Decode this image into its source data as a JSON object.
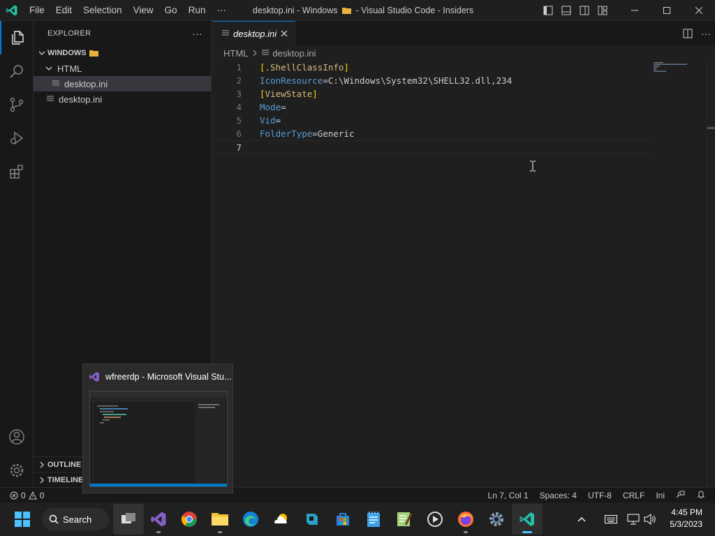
{
  "titlebar": {
    "menu": [
      "File",
      "Edit",
      "Selection",
      "View",
      "Go",
      "Run",
      "···"
    ],
    "title_prefix": "desktop.ini - Windows",
    "title_suffix": "- Visual Studio Code - Insiders"
  },
  "sidebar": {
    "header": "EXPLORER",
    "more": "···",
    "root": "WINDOWS",
    "folder": "HTML",
    "nested_file": "desktop.ini",
    "root_file": "desktop.ini",
    "outline": "OUTLINE",
    "timeline": "TIMELINE"
  },
  "editor": {
    "tab_label": "desktop.ini",
    "breadcrumb": [
      "HTML",
      "desktop.ini"
    ],
    "lines": [
      {
        "num": "1",
        "parts": [
          [
            "k-br",
            "["
          ],
          [
            "k-sec",
            ".ShellClassInfo"
          ],
          [
            "k-br",
            "]"
          ]
        ]
      },
      {
        "num": "2",
        "parts": [
          [
            "k-key",
            "IconResource"
          ],
          [
            "k-val",
            "=C:\\Windows\\System32\\SHELL32.dll,234"
          ]
        ]
      },
      {
        "num": "3",
        "parts": [
          [
            "k-br",
            "["
          ],
          [
            "k-sec",
            "ViewState"
          ],
          [
            "k-br",
            "]"
          ]
        ]
      },
      {
        "num": "4",
        "parts": [
          [
            "k-key",
            "Mode"
          ],
          [
            "k-val",
            "="
          ]
        ]
      },
      {
        "num": "5",
        "parts": [
          [
            "k-key",
            "Vid"
          ],
          [
            "k-val",
            "="
          ]
        ]
      },
      {
        "num": "6",
        "parts": [
          [
            "k-key",
            "FolderType"
          ],
          [
            "k-val",
            "=Generic"
          ]
        ]
      },
      {
        "num": "7",
        "parts": []
      }
    ]
  },
  "statusbar": {
    "errors": "0",
    "warnings": "0",
    "position": "Ln 7, Col 1",
    "spaces": "Spaces: 4",
    "encoding": "UTF-8",
    "eol": "CRLF",
    "language": "Ini"
  },
  "taskbar": {
    "search": "Search",
    "time": "4:45 PM",
    "date": "5/3/2023"
  },
  "preview": {
    "title": "wfreerdp - Microsoft Visual Stu..."
  },
  "colors": {
    "accent": "#0078d4",
    "vscode_blue": "#23a9f2",
    "vs_purple": "#865fc5",
    "folder_yellow": "#e8b33c"
  }
}
